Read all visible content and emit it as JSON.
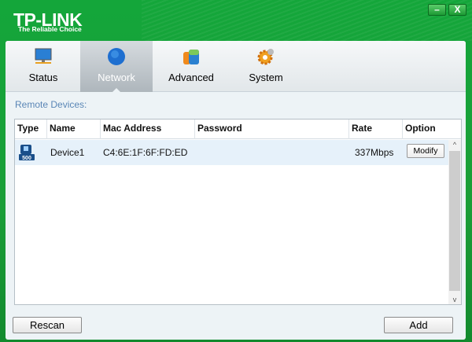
{
  "brand": {
    "name": "TP-LINK",
    "tagline": "The Reliable Choice"
  },
  "window": {
    "minimize": "–",
    "close": "X"
  },
  "tabs": [
    {
      "label": "Status",
      "icon": "monitor-icon"
    },
    {
      "label": "Network",
      "icon": "globe-icon",
      "active": true
    },
    {
      "label": "Advanced",
      "icon": "advanced-icon"
    },
    {
      "label": "System",
      "icon": "gear-icon"
    }
  ],
  "section_title": "Remote Devices:",
  "table": {
    "columns": [
      "Type",
      "Name",
      "Mac Address",
      "Password",
      "Rate",
      "Option"
    ],
    "rows": [
      {
        "type_icon": "powerline-500-icon",
        "type_badge": "500",
        "name": "Device1",
        "mac": "C4:6E:1F:6F:FD:ED",
        "password": "",
        "rate": "337Mbps",
        "option": "Modify"
      }
    ]
  },
  "buttons": {
    "rescan": "Rescan",
    "add": "Add"
  },
  "scroll": {
    "up": "^",
    "down": "v"
  }
}
